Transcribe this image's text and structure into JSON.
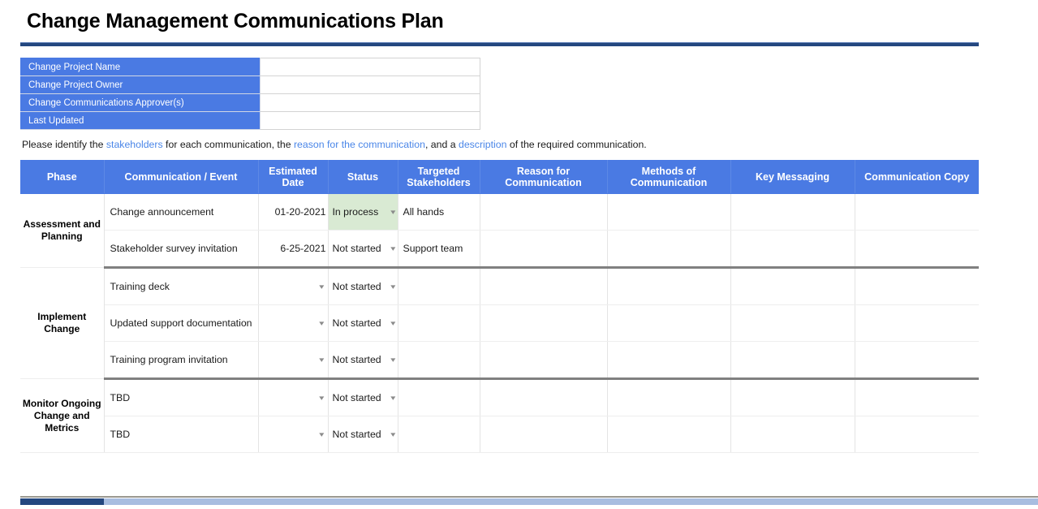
{
  "document": {
    "title": "Change Management Communications Plan",
    "accent_blue": "#4a7ae3",
    "rule_blue": "#24477f",
    "status_highlight_green": "#d9ead3",
    "link_blue": "#4a86e8"
  },
  "meta_form": {
    "rows": [
      {
        "label": "Change Project Name",
        "value": ""
      },
      {
        "label": "Change Project Owner",
        "value": ""
      },
      {
        "label": "Change Communications Approver(s)",
        "value": ""
      },
      {
        "label": "Last Updated",
        "value": ""
      }
    ]
  },
  "instruction": {
    "part1": "Please identify the ",
    "link1": "stakeholders",
    "part2": " for each communication, the ",
    "link2": "reason for the communication",
    "part3": ", and a ",
    "link3": "description",
    "part4": " of the required communication."
  },
  "grid": {
    "columns": [
      "Phase",
      "Communication / Event",
      "Estimated Date",
      "Status",
      "Targeted Stakeholders",
      "Reason for Communication",
      "Methods of Communication",
      "Key Messaging",
      "Communication Copy"
    ],
    "sections": [
      {
        "phase": "Assessment and Planning",
        "rows": [
          {
            "communication": "Change announcement",
            "estimated_date": "01-20-2021",
            "status": "In process",
            "status_highlighted": true,
            "targeted_stakeholders": "All hands",
            "reason": "",
            "methods": "",
            "key_messaging": "",
            "communication_copy": ""
          },
          {
            "communication": "Stakeholder survey invitation",
            "estimated_date": "6-25-2021",
            "status": "Not started",
            "status_highlighted": false,
            "targeted_stakeholders": "Support team",
            "reason": "",
            "methods": "",
            "key_messaging": "",
            "communication_copy": ""
          }
        ]
      },
      {
        "phase": "Implement Change",
        "rows": [
          {
            "communication": "Training deck",
            "estimated_date": "",
            "status": "Not started",
            "status_highlighted": false,
            "targeted_stakeholders": "",
            "reason": "",
            "methods": "",
            "key_messaging": "",
            "communication_copy": ""
          },
          {
            "communication": "Updated support documentation",
            "estimated_date": "",
            "status": "Not started",
            "status_highlighted": false,
            "targeted_stakeholders": "",
            "reason": "",
            "methods": "",
            "key_messaging": "",
            "communication_copy": ""
          },
          {
            "communication": "Training program invitation",
            "estimated_date": "",
            "status": "Not started",
            "status_highlighted": false,
            "targeted_stakeholders": "",
            "reason": "",
            "methods": "",
            "key_messaging": "",
            "communication_copy": ""
          }
        ]
      },
      {
        "phase": "Monitor Ongoing Change and Metrics",
        "rows": [
          {
            "communication": "TBD",
            "estimated_date": "",
            "status": "Not started",
            "status_highlighted": false,
            "targeted_stakeholders": "",
            "reason": "",
            "methods": "",
            "key_messaging": "",
            "communication_copy": ""
          },
          {
            "communication": "TBD",
            "estimated_date": "",
            "status": "Not started",
            "status_highlighted": false,
            "targeted_stakeholders": "",
            "reason": "",
            "methods": "",
            "key_messaging": "",
            "communication_copy": ""
          }
        ]
      }
    ]
  },
  "icons": {
    "dropdown_arrow": "▾"
  },
  "scrollbar": {
    "orientation": "horizontal",
    "thumb_fraction_percent": 8
  }
}
